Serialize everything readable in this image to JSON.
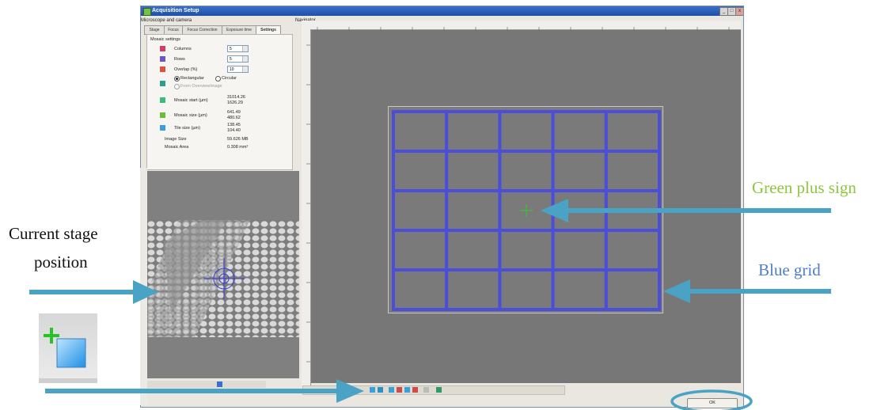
{
  "window": {
    "title": "Acquisition Setup",
    "minimize": "_",
    "maximize": "□",
    "close": "x"
  },
  "left_panel": {
    "header": "Microscope and camera",
    "tabs": [
      "Stage",
      "Focus",
      "Focus Correction",
      "Exposure time",
      "Settings"
    ],
    "active_tab": "Settings",
    "group_title": "Mosaic settings",
    "fields": {
      "columns_label": "Columns",
      "columns_value": "5",
      "rows_label": "Rows",
      "rows_value": "5",
      "overlap_label": "Overlap (%)",
      "overlap_value": "10",
      "rectangular_label": "Rectangular",
      "circular_label": "Circular",
      "from_overview_label": "From OverviewImage",
      "mosaic_start_label": "Mosaic start (µm)",
      "mosaic_start_x": "31014.26",
      "mosaic_start_y": "1626.29",
      "mosaic_size_label": "Mosaic size (µm)",
      "mosaic_size_x": "641.49",
      "mosaic_size_y": "480.62",
      "tile_size_label": "Tile size (µm)",
      "tile_size_x": "138.45",
      "tile_size_y": "104.40",
      "image_size_label": "Image Size",
      "image_size_value": "59.626 MB",
      "mosaic_area_label": "Mosaic Area",
      "mosaic_area_value": "0.308 mm²"
    }
  },
  "navigator": {
    "header": "Navigator",
    "grid": {
      "columns": 5,
      "rows": 5
    }
  },
  "ok_label": "OK",
  "annotations": {
    "current_stage_line1": "Current stage",
    "current_stage_line2": "position",
    "green_plus": "Green plus sign",
    "blue_grid": "Blue grid"
  },
  "colors": {
    "grid_blue": "#4a4ed8",
    "arrow_teal": "#4aa3c4",
    "green_label": "#8dc63f",
    "blue_label": "#4f7fc6"
  }
}
